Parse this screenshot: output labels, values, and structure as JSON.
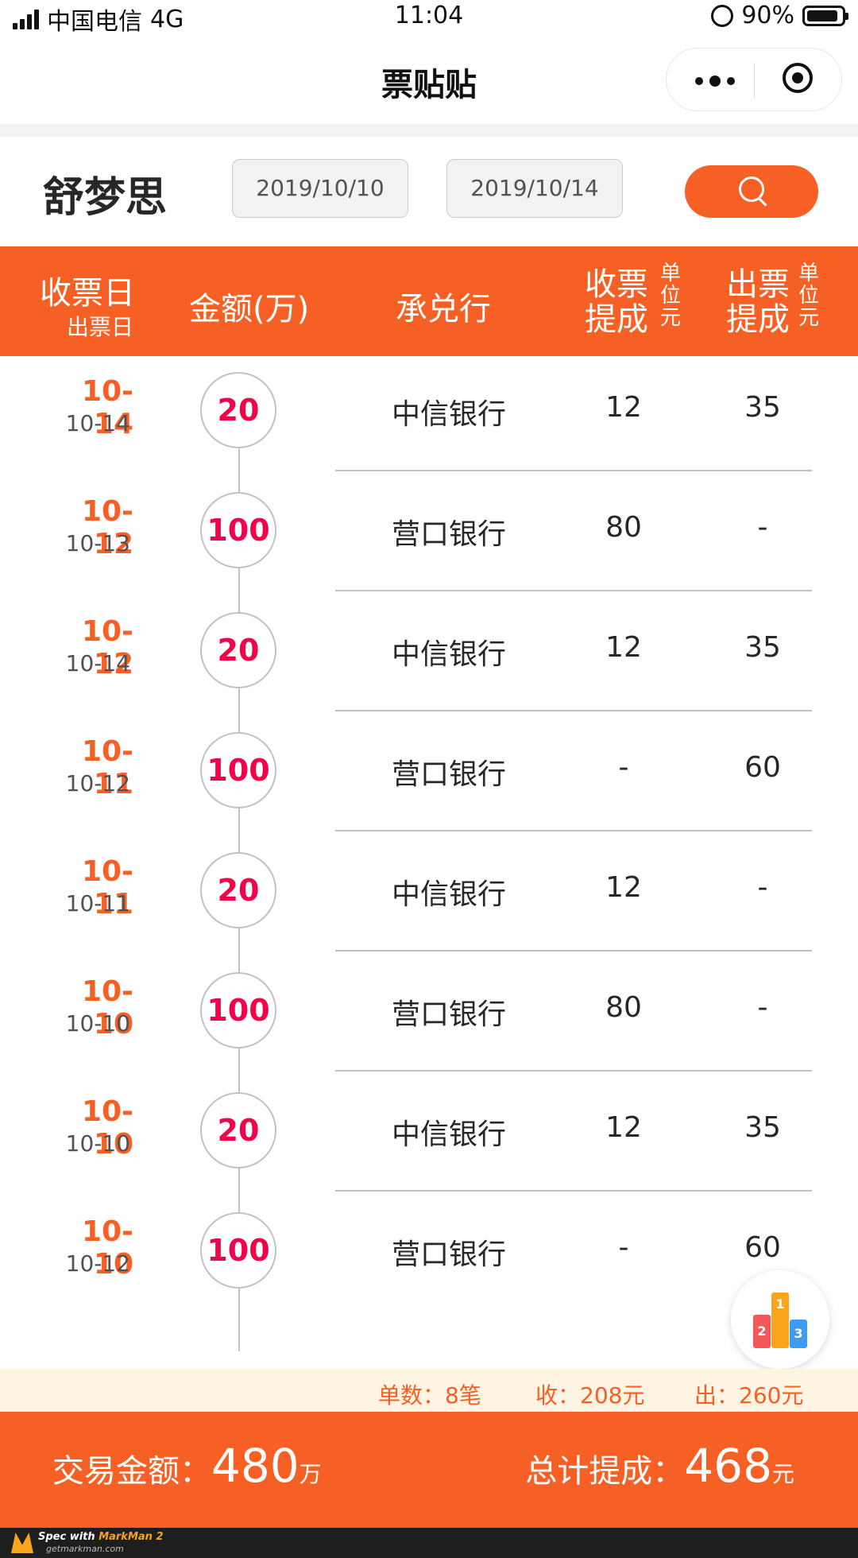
{
  "status_bar": {
    "carrier": "中国电信",
    "network": "4G",
    "time": "11:04",
    "battery": "90%"
  },
  "nav": {
    "title": "票贴贴"
  },
  "filter": {
    "user_name": "舒梦思",
    "date_start": "2019/10/10",
    "date_end": "2019/10/14",
    "search_icon": "search-icon"
  },
  "table_header": {
    "recv_date": "收票日",
    "issue_date": "出票日",
    "amount": "金额(万)",
    "bank": "承兑行",
    "recv_commission": "收票提成",
    "issue_commission": "出票提成",
    "unit": "单位元"
  },
  "rows": [
    {
      "recv_date": "10-14",
      "issue_date": "10-14",
      "amount": "20",
      "bank": "中信银行",
      "recv_commission": "12",
      "issue_commission": "35"
    },
    {
      "recv_date": "10-12",
      "issue_date": "10-13",
      "amount": "100",
      "bank": "营口银行",
      "recv_commission": "80",
      "issue_commission": "-"
    },
    {
      "recv_date": "10-12",
      "issue_date": "10-14",
      "amount": "20",
      "bank": "中信银行",
      "recv_commission": "12",
      "issue_commission": "35"
    },
    {
      "recv_date": "10-11",
      "issue_date": "10-12",
      "amount": "100",
      "bank": "营口银行",
      "recv_commission": "-",
      "issue_commission": "60"
    },
    {
      "recv_date": "10-11",
      "issue_date": "10-11",
      "amount": "20",
      "bank": "中信银行",
      "recv_commission": "12",
      "issue_commission": "-"
    },
    {
      "recv_date": "10-10",
      "issue_date": "10-10",
      "amount": "100",
      "bank": "营口银行",
      "recv_commission": "80",
      "issue_commission": "-"
    },
    {
      "recv_date": "10-10",
      "issue_date": "10-10",
      "amount": "20",
      "bank": "中信银行",
      "recv_commission": "12",
      "issue_commission": "35"
    },
    {
      "recv_date": "10-10",
      "issue_date": "10-12",
      "amount": "100",
      "bank": "营口银行",
      "recv_commission": "-",
      "issue_commission": "60"
    }
  ],
  "rank_button": {
    "icon": "podium-icon",
    "places": [
      "2",
      "1",
      "3"
    ]
  },
  "summary": {
    "count": "单数：8笔",
    "recv_total": "收：208元",
    "issue_total": "出：260元"
  },
  "totals": {
    "amount_label": "交易金额：",
    "amount_value": "480",
    "amount_unit": "万",
    "commission_label": "总计提成：",
    "commission_value": "468",
    "commission_unit": "元"
  },
  "footer": {
    "brand_prefix": "Spec with ",
    "brand": "MarkMan 2",
    "site": "getmarkman.com"
  },
  "colors": {
    "accent": "#f76024",
    "date_text": "#f85f24",
    "amount": "#f1034a",
    "text": "#272727",
    "line": "#c2c2c2"
  }
}
